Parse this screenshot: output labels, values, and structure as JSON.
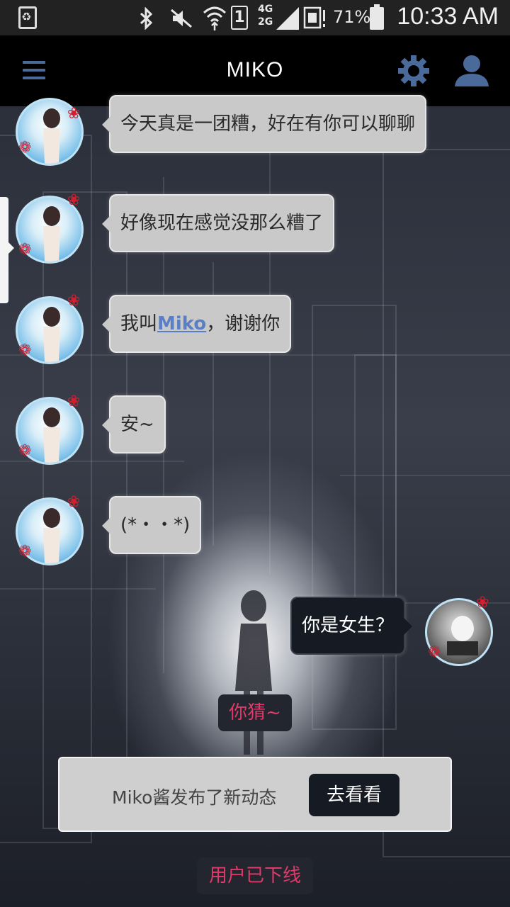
{
  "status_bar": {
    "battery_percent": "71%",
    "time": "10:33 AM",
    "icons": [
      "recycle-icon",
      "bluetooth-icon",
      "mute-icon",
      "wifi-icon",
      "sim-1-icon",
      "signal-4g-2g-icon",
      "sim-card-icon"
    ],
    "network_label_top": "4G",
    "network_label_bottom": "2G",
    "sim_label": "1"
  },
  "app_bar": {
    "title": "MIKO",
    "menu_icon": "hamburger-menu-icon",
    "settings_icon": "gear-icon",
    "profile_icon": "user-icon",
    "accent": "#4a6a9a"
  },
  "messages": [
    {
      "from": "miko",
      "text": "今天真是一团糟，好在有你可以聊聊"
    },
    {
      "from": "miko",
      "text": "好像现在感觉没那么糟了"
    },
    {
      "from": "miko",
      "text_before": "我叫",
      "link": "Miko",
      "text_after": "，谢谢你"
    },
    {
      "from": "miko",
      "text": "安~"
    },
    {
      "from": "miko",
      "text": "(*・・*)"
    },
    {
      "from": "me",
      "text": "你是女生？"
    }
  ],
  "system": {
    "guess": "你猜~",
    "offline": "用户已下线",
    "color": "#e03a6a"
  },
  "notice": {
    "text": "Miko酱发布了新动态",
    "button": "去看看"
  }
}
